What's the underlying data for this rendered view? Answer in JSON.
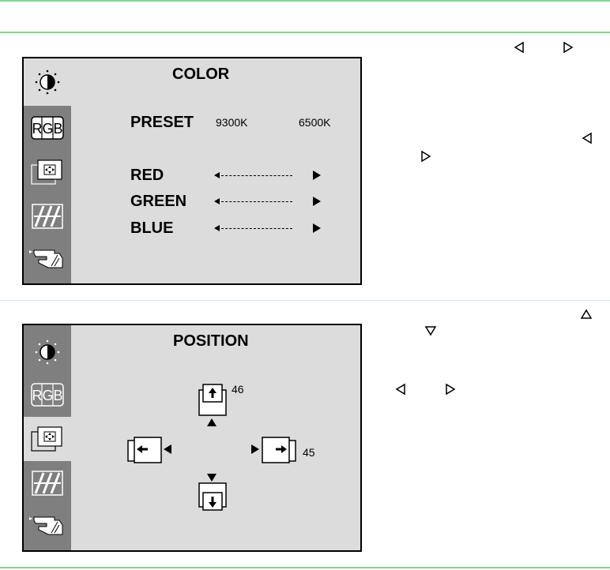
{
  "color_panel": {
    "title": "COLOR",
    "preset_label": "PRESET",
    "preset_option_1": "9300K",
    "preset_option_2": "6500K",
    "rows": [
      {
        "label": "RED"
      },
      {
        "label": "GREEN"
      },
      {
        "label": "BLUE"
      }
    ]
  },
  "position_panel": {
    "title": "POSITION",
    "vertical_value": "46",
    "horizontal_value": "45"
  },
  "sidebar": {
    "icons": [
      "brightness-icon",
      "rgb-icon",
      "position-icon",
      "geometry-icon",
      "hand-icon"
    ],
    "rgb_text": "RGB"
  },
  "colors": {
    "divider": "#7fd98a",
    "panel_bg": "#dcdcdc",
    "sidebar_bg": "#7f7f7f"
  }
}
